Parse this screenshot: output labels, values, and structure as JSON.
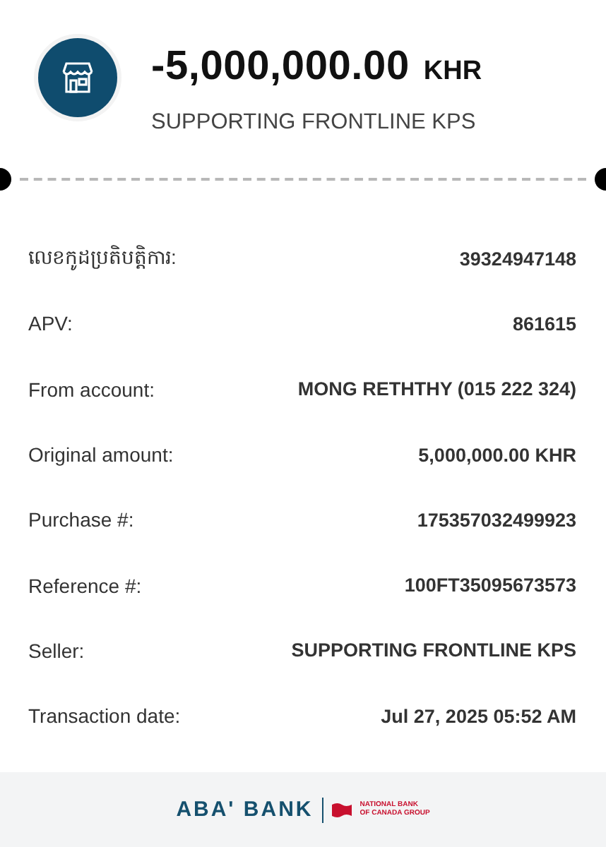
{
  "header": {
    "amount": "-5,000,000.00",
    "currency": "KHR",
    "merchant": "SUPPORTING FRONTLINE KPS"
  },
  "details": [
    {
      "label": "លេខកូដប្រតិបត្តិការ:",
      "value": "39324947148"
    },
    {
      "label": "APV:",
      "value": "861615"
    },
    {
      "label": "From account:",
      "value": "MONG RETHTHY (015 222 324)"
    },
    {
      "label": "Original amount:",
      "value": "5,000,000.00 KHR"
    },
    {
      "label": "Purchase #:",
      "value": "175357032499923"
    },
    {
      "label": "Reference #:",
      "value": "100FT35095673573"
    },
    {
      "label": "Seller:",
      "value": "SUPPORTING FRONTLINE KPS"
    },
    {
      "label": "Transaction date:",
      "value": "Jul 27, 2025 05:52 AM"
    }
  ],
  "footer": {
    "bank": "ABA' BANK",
    "group_line_1": "NATIONAL BANK",
    "group_line_2": "OF CANADA GROUP"
  }
}
